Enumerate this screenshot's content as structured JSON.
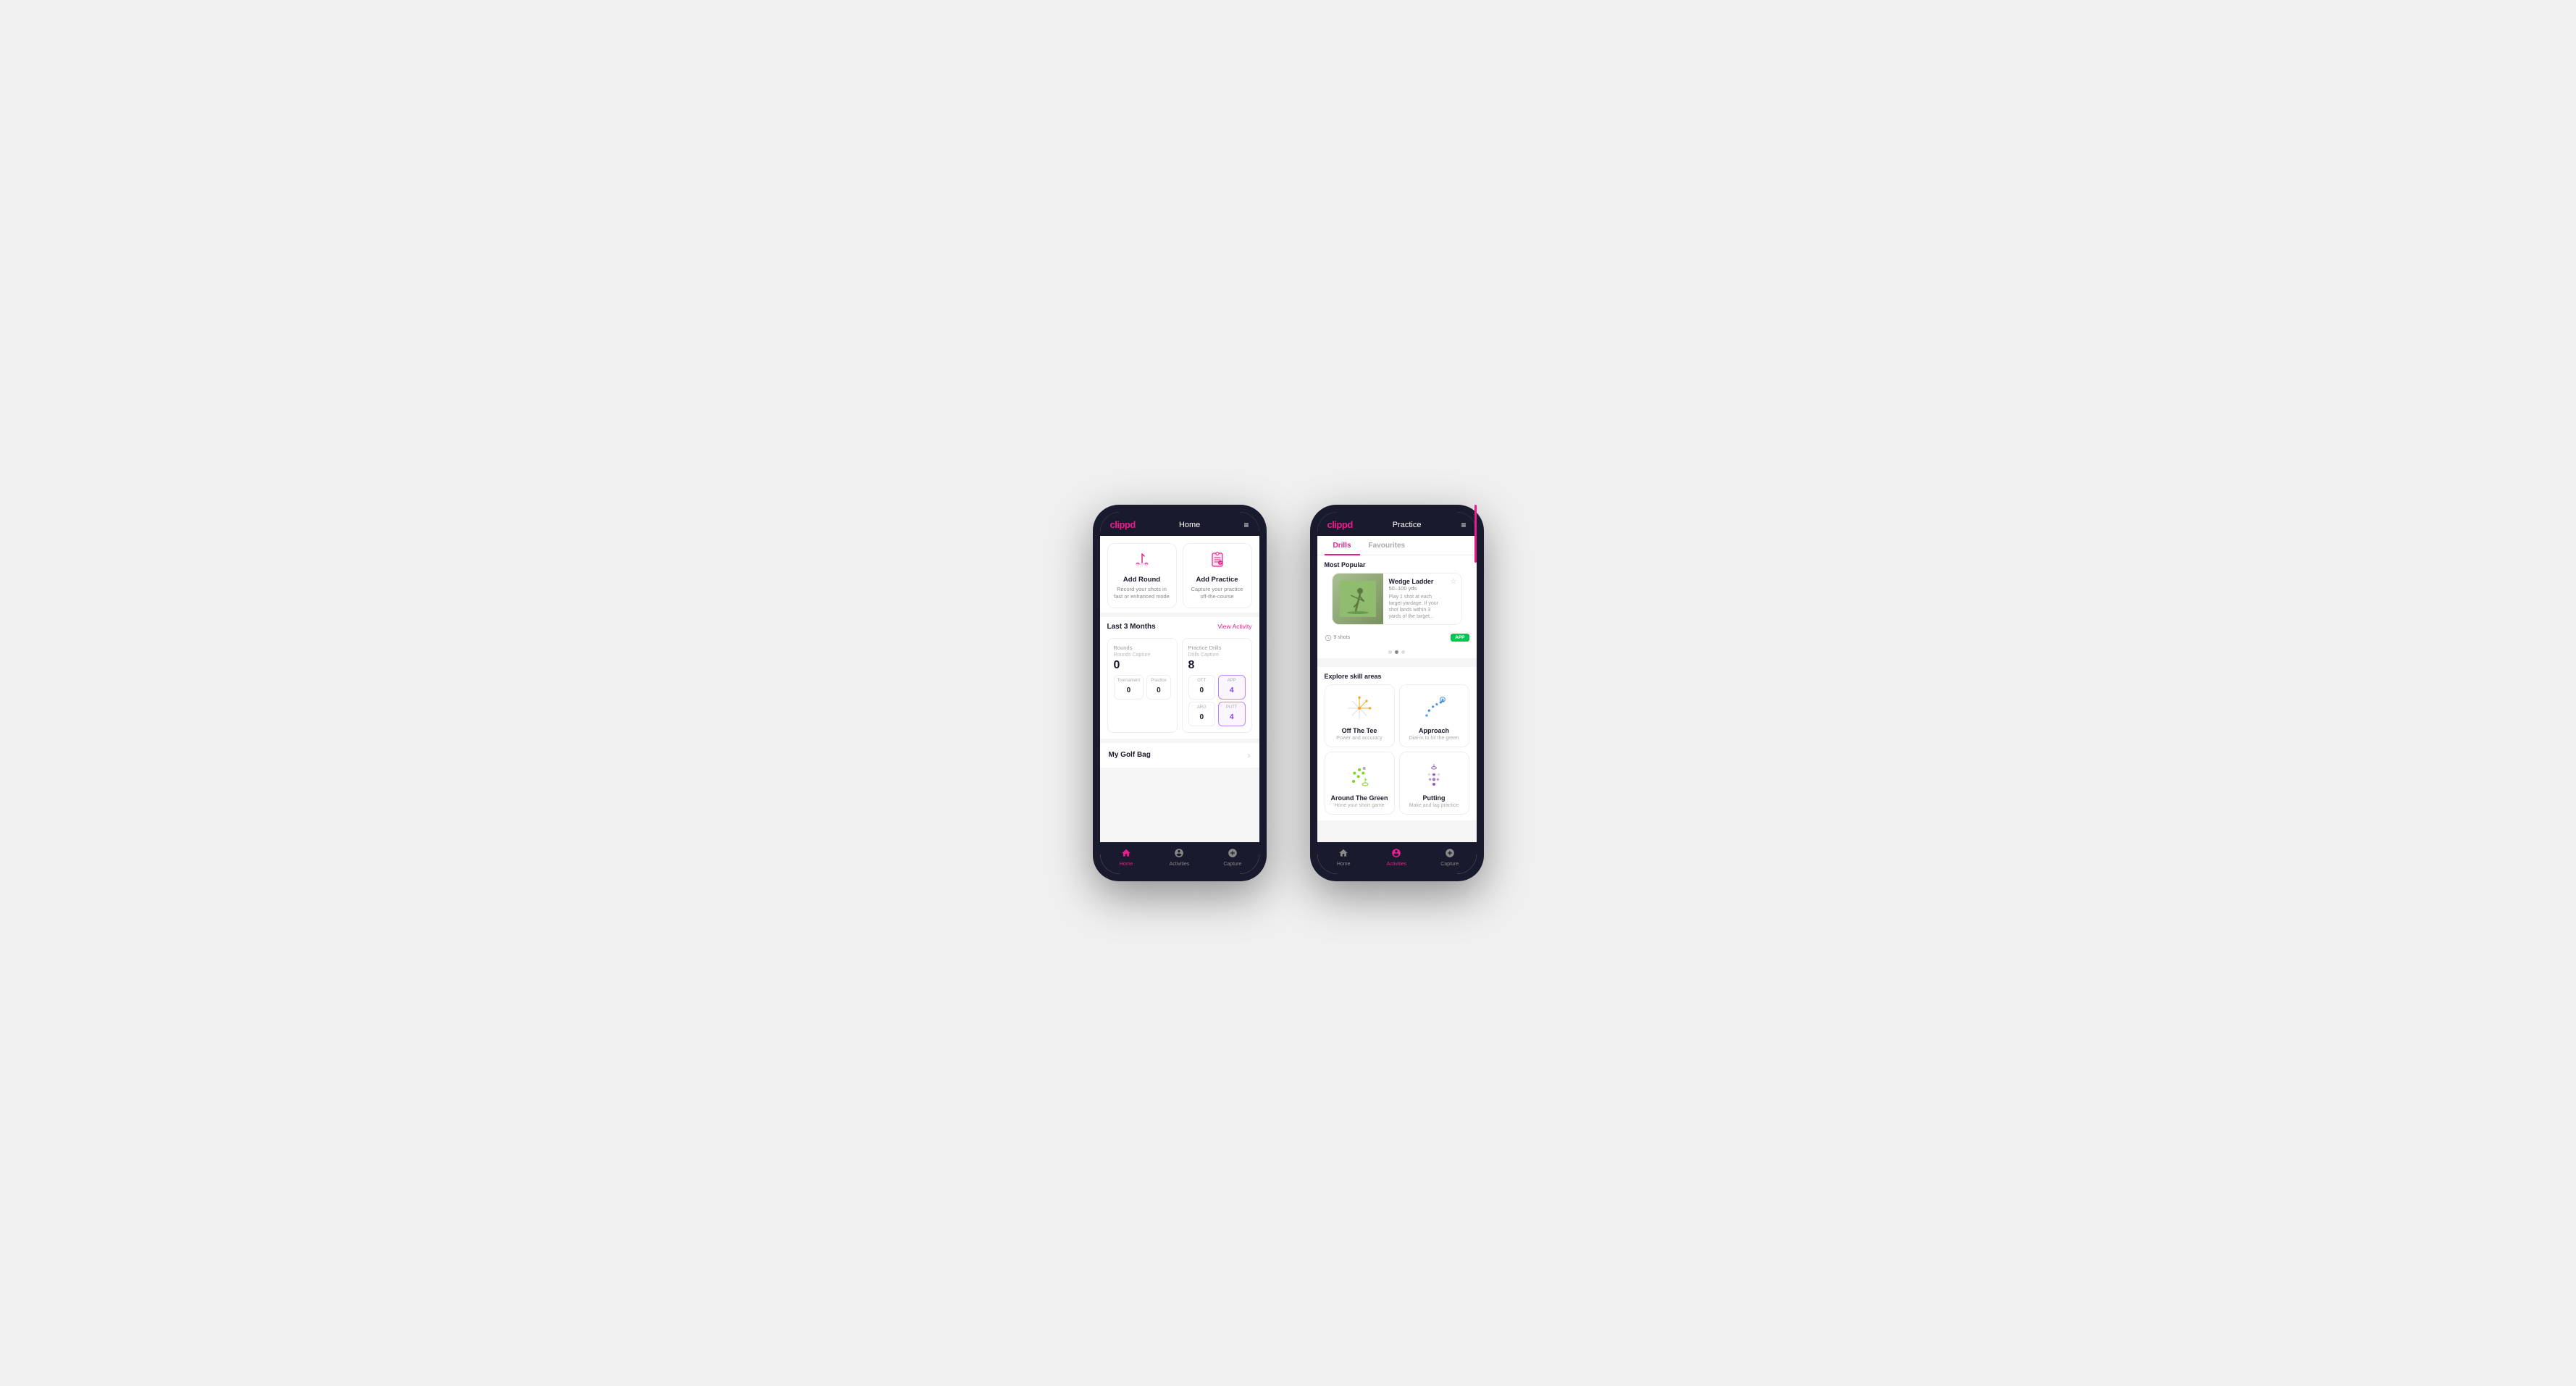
{
  "phone1": {
    "header": {
      "logo": "clippd",
      "title": "Home",
      "menu_icon": "≡"
    },
    "cards": [
      {
        "id": "add-round",
        "icon": "⛳",
        "title": "Add Round",
        "desc": "Record your shots in fast or enhanced mode"
      },
      {
        "id": "add-practice",
        "icon": "📋",
        "title": "Add Practice",
        "desc": "Capture your practice off-the-course"
      }
    ],
    "activity": {
      "section_title": "Last 3 Months",
      "view_link": "View Activity",
      "rounds": {
        "label": "Rounds",
        "capture_label": "Rounds Capture",
        "total": "0",
        "sub": [
          {
            "label": "Tournament",
            "value": "0"
          },
          {
            "label": "Practice",
            "value": "0"
          }
        ]
      },
      "drills": {
        "label": "Practice Drills",
        "capture_label": "Drills Capture",
        "total": "8",
        "sub": [
          {
            "label": "OTT",
            "value": "0"
          },
          {
            "label": "APP",
            "value": "4",
            "highlighted": true
          },
          {
            "label": "ARG",
            "value": "0"
          },
          {
            "label": "PUTT",
            "value": "4",
            "highlighted": true
          }
        ]
      }
    },
    "golf_bag": {
      "label": "My Golf Bag"
    },
    "nav": [
      {
        "icon": "🏠",
        "label": "Home",
        "active": true
      },
      {
        "icon": "⛳",
        "label": "Activities",
        "active": false
      },
      {
        "icon": "➕",
        "label": "Capture",
        "active": false
      }
    ]
  },
  "phone2": {
    "header": {
      "logo": "clippd",
      "title": "Practice",
      "menu_icon": "≡"
    },
    "tabs": [
      {
        "label": "Drills",
        "active": true
      },
      {
        "label": "Favourites",
        "active": false
      }
    ],
    "most_popular": {
      "label": "Most Popular",
      "drill": {
        "name": "Wedge Ladder",
        "yds": "50–100 yds",
        "desc": "Play 1 shot at each target yardage. If your shot lands within 3 yards of the target...",
        "shots": "9 shots",
        "badge": "APP"
      },
      "dots": [
        false,
        true,
        false
      ]
    },
    "explore": {
      "label": "Explore skill areas",
      "skills": [
        {
          "id": "off-the-tee",
          "title": "Off The Tee",
          "desc": "Power and accuracy",
          "color": "#f5a623"
        },
        {
          "id": "approach",
          "title": "Approach",
          "desc": "Dial-in to hit the green",
          "color": "#4a90d9"
        },
        {
          "id": "around-the-green",
          "title": "Around The Green",
          "desc": "Hone your short game",
          "color": "#7ed321"
        },
        {
          "id": "putting",
          "title": "Putting",
          "desc": "Make and lag practice",
          "color": "#9b59b6"
        }
      ]
    },
    "nav": [
      {
        "icon": "🏠",
        "label": "Home",
        "active": false
      },
      {
        "icon": "⛳",
        "label": "Activities",
        "active": true
      },
      {
        "icon": "➕",
        "label": "Capture",
        "active": false
      }
    ]
  }
}
